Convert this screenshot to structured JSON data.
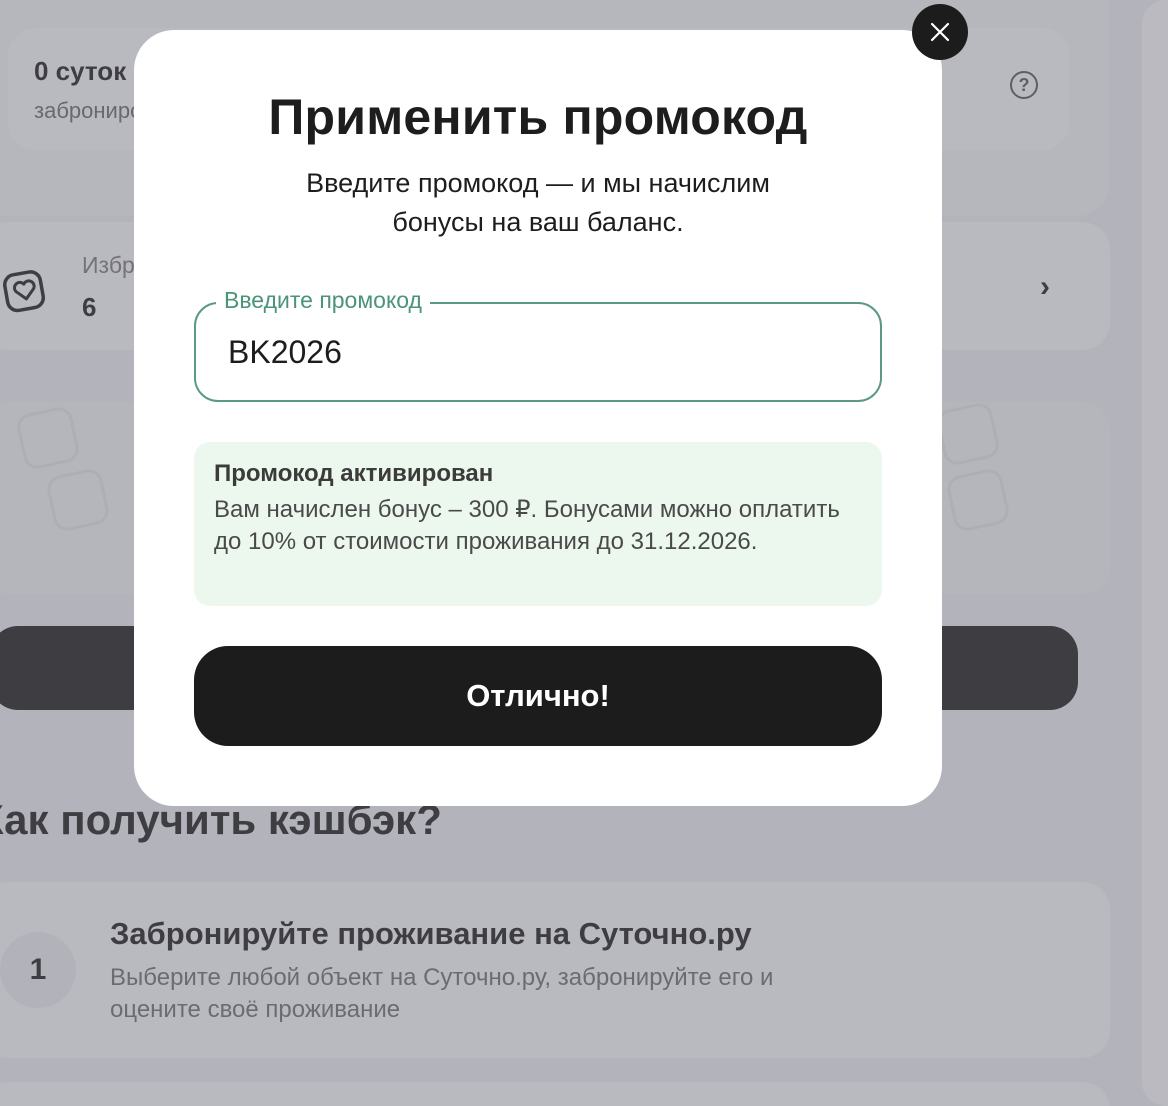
{
  "background": {
    "stats": {
      "value": "0 суток",
      "caption": "забронировано",
      "help_icon": "question-circle-icon"
    },
    "favorites": {
      "label": "Избранное",
      "count": "6",
      "icon": "heart-frame-icon",
      "chevron": "chevron-right-icon"
    },
    "cashback": {
      "heading": "Как получить кэшбэк?",
      "steps": [
        {
          "number": "1",
          "title": "Забронируйте проживание на Суточно.ру",
          "description": "Выберите любой объект на Суточно.ру, забронируйте его и оцените своё проживание"
        }
      ]
    }
  },
  "modal": {
    "title": "Применить промокод",
    "subtitle": "Введите промокод — и мы начислим бонусы на ваш баланс.",
    "close_icon": "close-icon",
    "promo_field": {
      "label": "Введите промокод",
      "value": "BK2026"
    },
    "success": {
      "title": "Промокод активирован",
      "text": "Вам начислен бонус – 300 ₽. Бонусами можно оплатить до 10% от стоимости проживания до 31.12.2026."
    },
    "confirm_label": "Отлично!"
  },
  "colors": {
    "accent_green": "#4a9477",
    "success_bg": "#ecf8ee",
    "button_dark": "#1c1c1c"
  }
}
